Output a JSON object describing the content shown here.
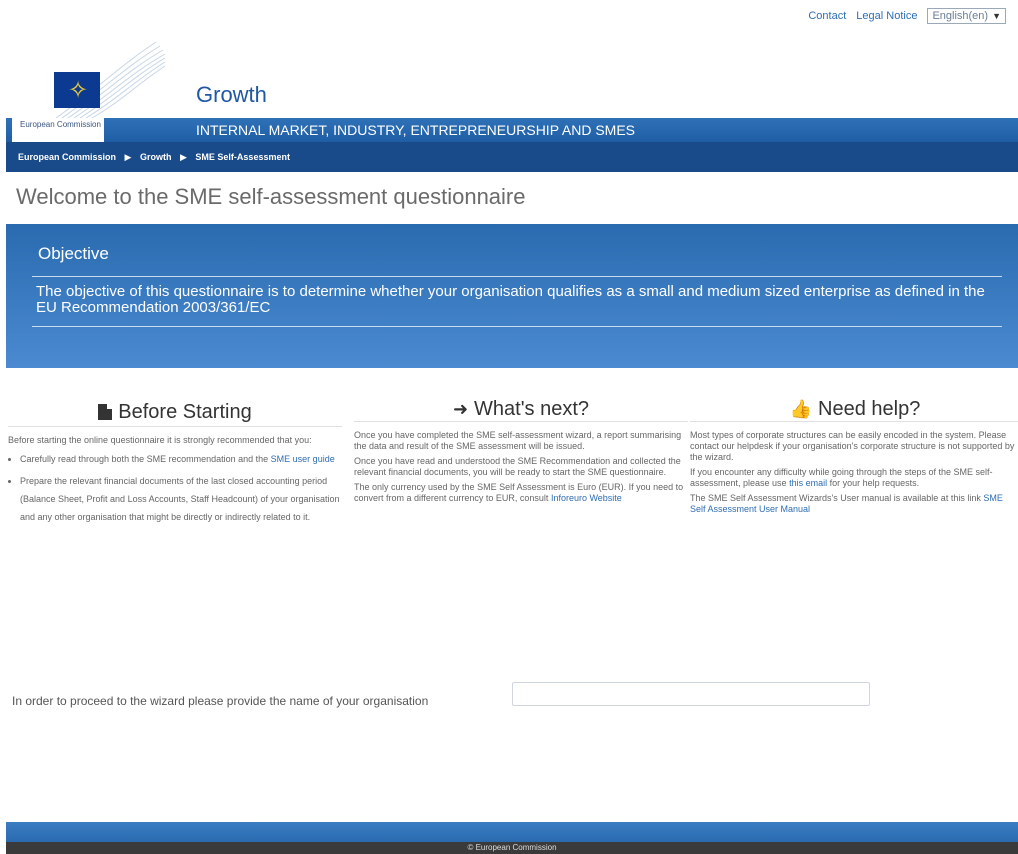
{
  "top_links": {
    "contact": "Contact",
    "legal": "Legal Notice",
    "language": "English(en)"
  },
  "header": {
    "commission_label": "European Commission",
    "site_name": "Growth",
    "dg_title": "INTERNAL MARKET, INDUSTRY, ENTREPRENEURSHIP AND SMES"
  },
  "breadcrumb": [
    "European Commission",
    "Growth",
    "SME Self-Assessment"
  ],
  "page_title": "Welcome to the SME self-assessment questionnaire",
  "objective": {
    "title": "Objective",
    "text": "The objective of this questionnaire is to determine whether your organisation qualifies as a small and medium sized enterprise as defined in the EU Recommendation 2003/361/EC"
  },
  "columns": {
    "before": {
      "title": "Before Starting",
      "intro": "Before starting the online questionnaire it is strongly recommended that you:",
      "item1_text": "Carefully read through both the SME recommendation and the",
      "item1_link": "SME user guide",
      "item2_text": "Prepare the relevant financial documents of the last closed accounting period (Balance Sheet, Profit and Loss Accounts, Staff Headcount) of your organisation and any other organisation that might be directly or indirectly related to it."
    },
    "next": {
      "title": "What's next?",
      "p1": "Once you have completed the SME self-assessment wizard, a report summarising the data and result of the SME assessment will be issued.",
      "p2": "Once you have read and understood the SME Recommendation and collected the relevant financial documents, you will be ready to start the SME questionnaire.",
      "p3": "The only currency used by the SME Self Assessment is Euro (EUR). If you need to convert from a different currency to EUR, consult",
      "p3_link": "Inforeuro Website"
    },
    "help": {
      "title": "Need help?",
      "p1": "Most types of corporate structures can be easily encoded in the system. Please contact our helpdesk if your organisation's corporate structure is not supported by the wizard.",
      "p2_pre": "If you encounter any difficulty while going through the steps of the SME self-assessment, please use",
      "p2_link": "this email",
      "p2_post": "for your help requests.",
      "p3": "The SME Self Assessment Wizards's User manual is available at this link",
      "p3_link": "SME Self Assessment User Manual"
    }
  },
  "proceed_label": "In order to proceed to the wizard please provide the name of your organisation",
  "org_input": {
    "value": "",
    "placeholder": ""
  },
  "footer_text": "© European Commission"
}
